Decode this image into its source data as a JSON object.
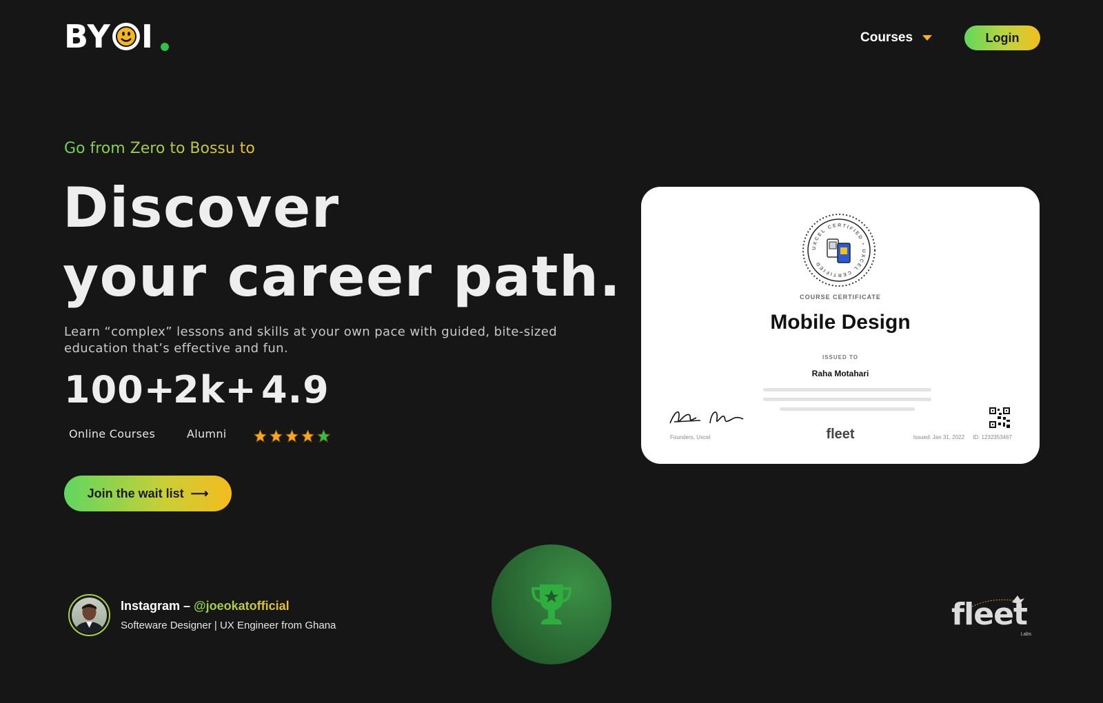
{
  "header": {
    "logo_text": "BYOI",
    "nav_courses_label": "Courses",
    "login_label": "Login"
  },
  "hero": {
    "eyebrow": "Go from Zero to Bossu to",
    "headline_line1": "Discover",
    "headline_line2": "your career path.",
    "lead": "Learn “complex” lessons and skills at your own pace with guided, bite-sized education that’s effective and fun.",
    "stats": [
      {
        "value": "100+",
        "label": "Online Courses"
      },
      {
        "value": "2k+",
        "label": "Alumni"
      },
      {
        "value": "4.9",
        "label": ""
      }
    ],
    "rating_stars": 5,
    "waitlist_label": "Join the wait list",
    "waitlist_arrow": "⟶"
  },
  "certificate": {
    "seal_text": "UXCEL CERTIFIED",
    "kicker": "COURSE CERTIFICATE",
    "title": "Mobile Design",
    "issued_to_label": "ISSUED TO",
    "recipient": "Raha Motahari",
    "founders": "Founders, Uxcel",
    "brand": "fleet",
    "issued_date": "Issued: Jan 31, 2022",
    "cert_id": "ID: 1232353467"
  },
  "footer": {
    "profile_prefix": "Instagram – ",
    "profile_handle": "@joeokatofficial",
    "profile_bio": "Softeware Designer | UX Engineer from Ghana",
    "partner_logo_text": "fleet",
    "partner_logo_sub": "Labs"
  },
  "colors": {
    "background": "#161616",
    "accent_green": "#62d65d",
    "accent_yellow": "#f3bd1f",
    "trophy_green": "#2fae3f"
  }
}
